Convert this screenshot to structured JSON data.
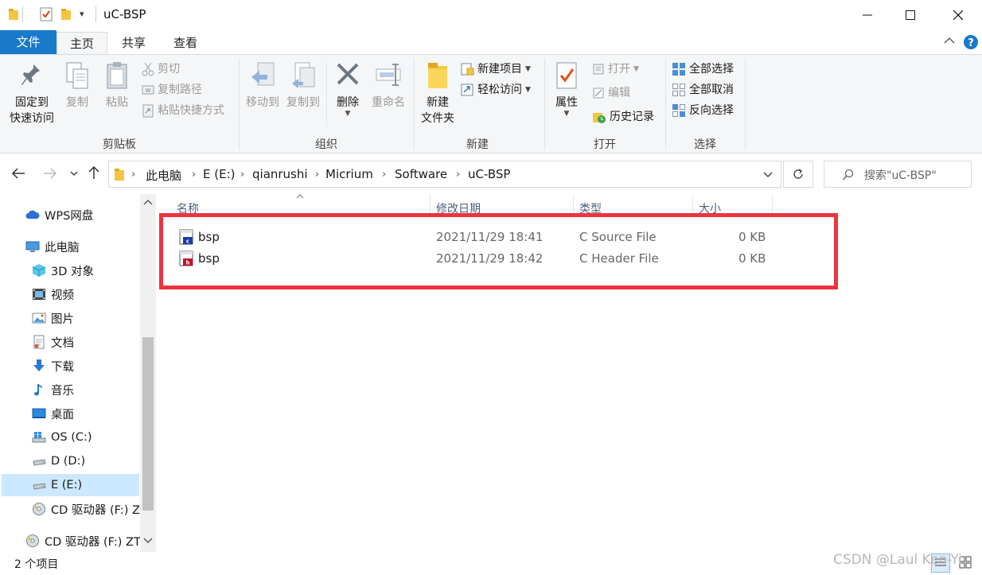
{
  "window": {
    "title": "uC-BSP",
    "quick_access_arrow": "▾"
  },
  "ribbon_tabs": {
    "file": "文件",
    "home": "主页",
    "share": "共享",
    "view": "查看"
  },
  "ribbon": {
    "clipboard": {
      "label": "剪贴板",
      "pin_line1": "固定到",
      "pin_line2": "快速访问",
      "copy": "复制",
      "paste": "粘贴",
      "cut": "剪切",
      "copy_path": "复制路径",
      "paste_shortcut": "粘贴快捷方式"
    },
    "organize": {
      "label": "组织",
      "move_to": "移动到",
      "copy_to": "复制到",
      "delete": "删除",
      "rename": "重命名"
    },
    "new": {
      "label": "新建",
      "new_folder_line1": "新建",
      "new_folder_line2": "文件夹",
      "new_item": "新建项目",
      "easy_access": "轻松访问"
    },
    "open": {
      "label": "打开",
      "properties": "属性",
      "open": "打开",
      "edit": "编辑",
      "history": "历史记录"
    },
    "select": {
      "label": "选择",
      "select_all": "全部选择",
      "select_none": "全部取消",
      "invert": "反向选择"
    }
  },
  "address": {
    "crumbs": [
      "此电脑",
      "E (E:)",
      "qianrushi",
      "Micrium",
      "Software",
      "uC-BSP"
    ],
    "search_placeholder": "搜索\"uC-BSP\""
  },
  "nav": {
    "items": [
      {
        "label": "WPS网盘",
        "icon": "cloud-icon"
      },
      {
        "label": "此电脑",
        "icon": "computer-icon"
      },
      {
        "label": "3D 对象",
        "icon": "cube-icon"
      },
      {
        "label": "视频",
        "icon": "video-icon"
      },
      {
        "label": "图片",
        "icon": "picture-icon"
      },
      {
        "label": "文档",
        "icon": "document-icon"
      },
      {
        "label": "下载",
        "icon": "download-icon"
      },
      {
        "label": "音乐",
        "icon": "music-icon"
      },
      {
        "label": "桌面",
        "icon": "desktop-icon"
      },
      {
        "label": "OS (C:)",
        "icon": "windows-drive-icon"
      },
      {
        "label": "D (D:)",
        "icon": "drive-icon"
      },
      {
        "label": "E (E:)",
        "icon": "drive-icon"
      },
      {
        "label": "CD 驱动器 (F:) Z",
        "icon": "cd-drive-icon"
      },
      {
        "label": "CD 驱动器 (F:) ZT",
        "icon": "cd-drive-icon"
      }
    ]
  },
  "columns": {
    "name": "名称",
    "date": "修改日期",
    "type": "类型",
    "size": "大小"
  },
  "files": [
    {
      "name": "bsp",
      "date": "2021/11/29 18:41",
      "type": "C Source File",
      "size": "0 KB",
      "icon": "c-source-file-icon",
      "accent": "#1a3aa8"
    },
    {
      "name": "bsp",
      "date": "2021/11/29 18:42",
      "type": "C Header File",
      "size": "0 KB",
      "icon": "c-header-file-icon",
      "accent": "#c8102e"
    }
  ],
  "status": {
    "count": "2 个项目"
  },
  "watermark": "CSDN @Laul Ken-Yi",
  "colors": {
    "file_tab": "#1979ca",
    "highlight_box": "#ee3340",
    "selected_nav": "#cce8ff"
  }
}
